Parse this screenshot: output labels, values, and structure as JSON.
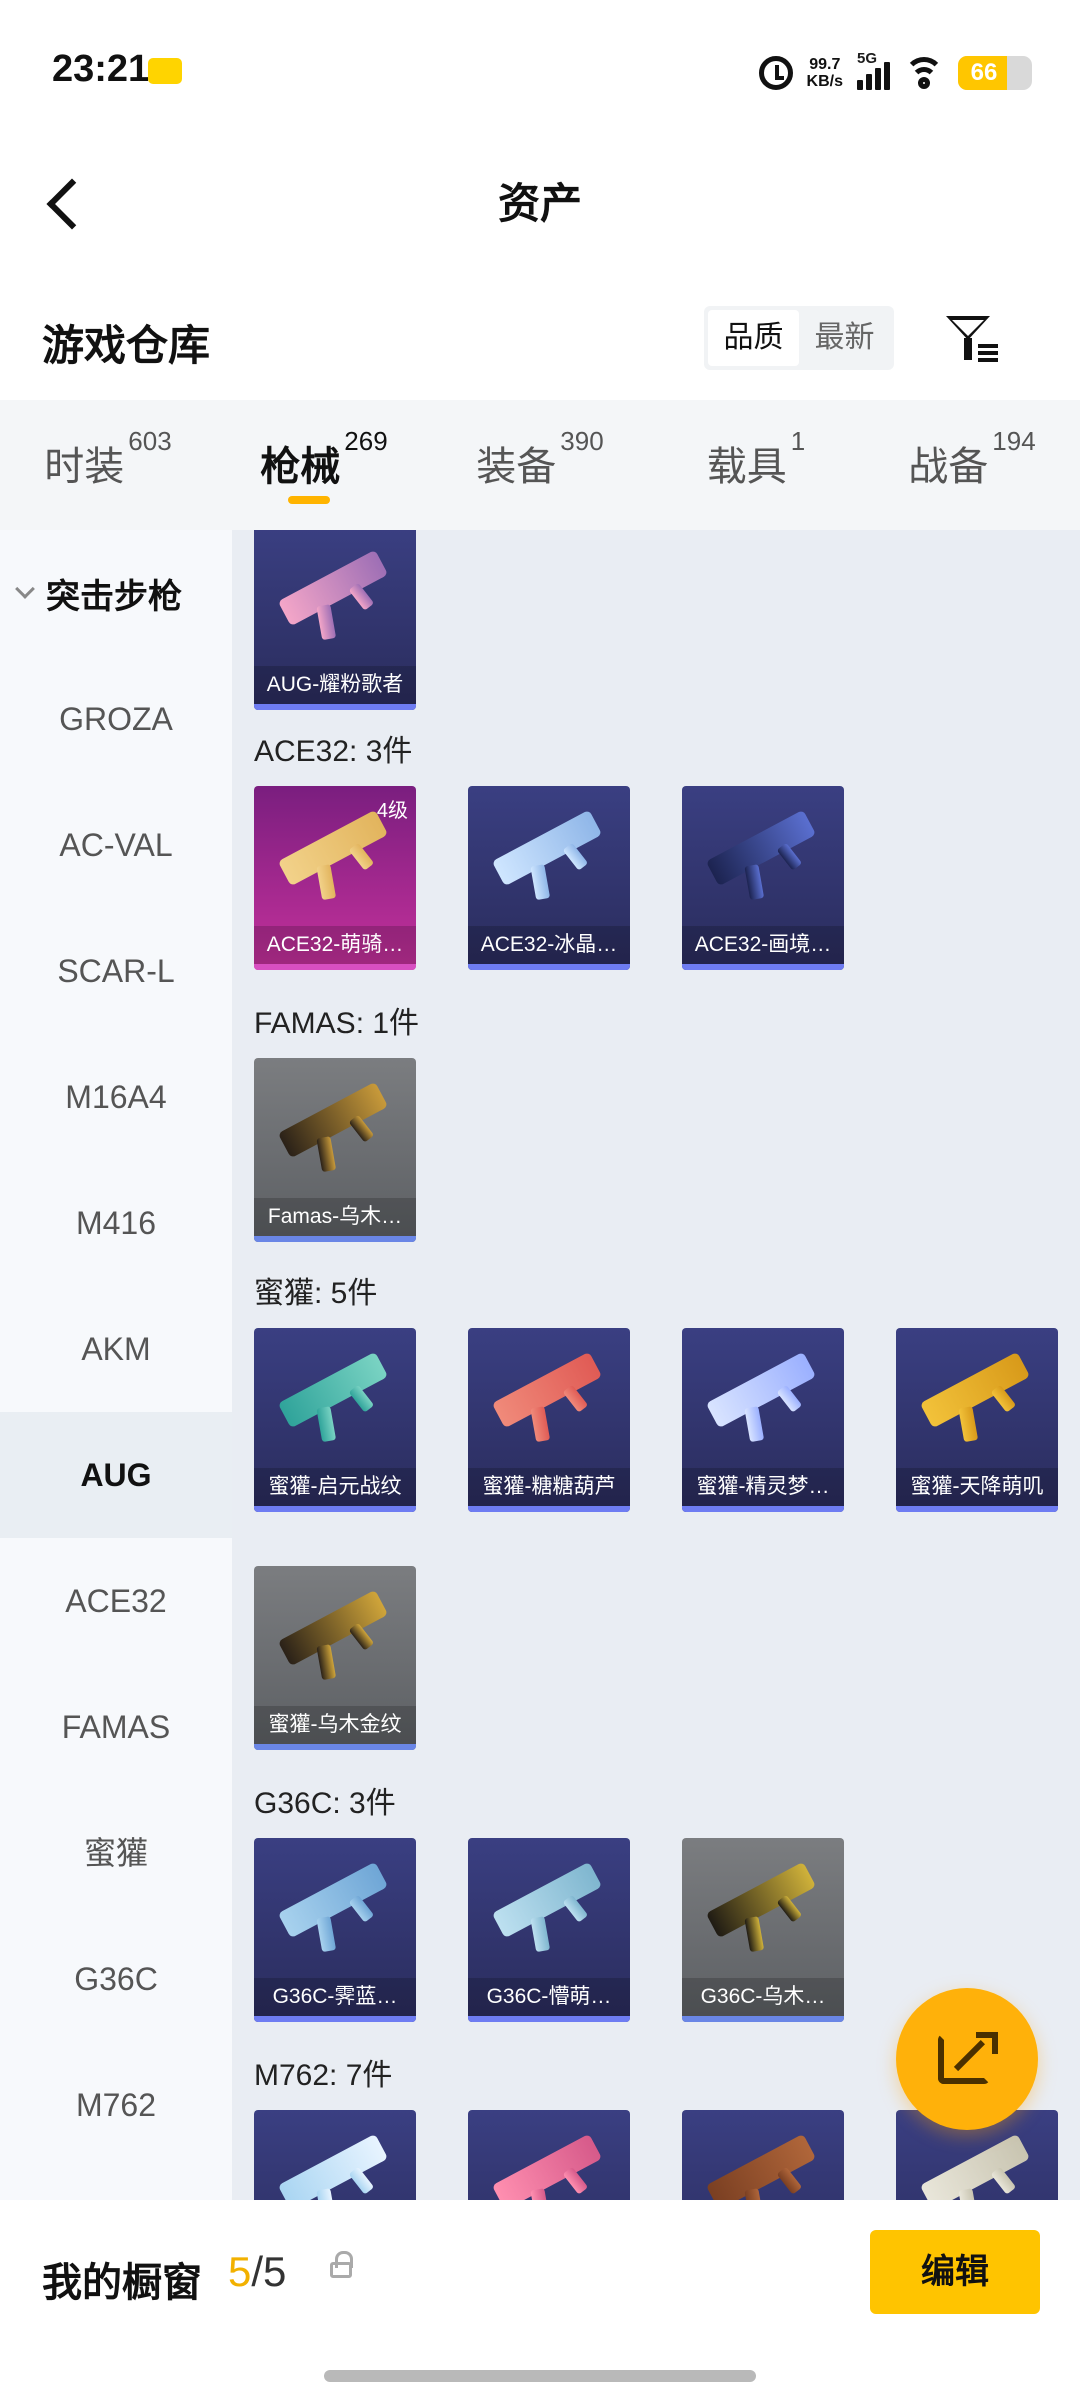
{
  "status_bar": {
    "time": "23:21",
    "net_speed_value": "99.7",
    "net_speed_unit": "KB/s",
    "network": "5G",
    "battery": "66",
    "battery_level": 0.66
  },
  "header": {
    "title": "资产"
  },
  "warehouse": {
    "title": "游戏仓库",
    "sort_options": [
      "品质",
      "最新"
    ],
    "active_sort": "品质"
  },
  "tabs": [
    {
      "label": "时装",
      "count": "603"
    },
    {
      "label": "枪械",
      "count": "269",
      "active": true
    },
    {
      "label": "装备",
      "count": "390"
    },
    {
      "label": "载具",
      "count": "1"
    },
    {
      "label": "战备",
      "count": "194"
    }
  ],
  "side_nav": {
    "category": "突击步枪",
    "items": [
      "GROZA",
      "AC-VAL",
      "SCAR-L",
      "M16A4",
      "M416",
      "AKM",
      "AUG",
      "ACE32",
      "FAMAS",
      "蜜獾",
      "G36C",
      "M762"
    ],
    "active": "AUG"
  },
  "groups": [
    {
      "title": "",
      "items": [
        {
          "name": "AUG-耀粉歌者",
          "tier": "epic",
          "colors": [
            "#f4a6c8",
            "#9e6fb5"
          ]
        }
      ]
    },
    {
      "title": "ACE32: 3件",
      "items": [
        {
          "name": "ACE32-萌骑…",
          "tier": "legend",
          "level": "4级",
          "colors": [
            "#f2d28a",
            "#e2b45d"
          ]
        },
        {
          "name": "ACE32-冰晶…",
          "tier": "epic",
          "colors": [
            "#cfe6ff",
            "#8fb6e8"
          ]
        },
        {
          "name": "ACE32-画境…",
          "tier": "epic",
          "colors": [
            "#1c2350",
            "#5a6fd0"
          ]
        }
      ]
    },
    {
      "title": "FAMAS: 1件",
      "items": [
        {
          "name": "Famas-乌木…",
          "tier": "rare",
          "colors": [
            "#2a2118",
            "#c89a3a"
          ]
        }
      ]
    },
    {
      "title": "蜜獾: 5件",
      "items": [
        {
          "name": "蜜獾-启元战纹",
          "tier": "epic",
          "colors": [
            "#2fa39a",
            "#7ad3c3"
          ]
        },
        {
          "name": "蜜獾-糖糖葫芦",
          "tier": "epic",
          "colors": [
            "#f08a7a",
            "#e05b55"
          ]
        },
        {
          "name": "蜜獾-精灵梦…",
          "tier": "epic",
          "colors": [
            "#d9e4ff",
            "#9bb0ff"
          ]
        },
        {
          "name": "蜜獾-天降萌叽",
          "tier": "epic",
          "colors": [
            "#f2c23a",
            "#d89a1a"
          ]
        },
        {
          "name": "蜜獾-乌木金纹",
          "tier": "rare",
          "colors": [
            "#2a2118",
            "#d0a53a"
          ]
        }
      ]
    },
    {
      "title": "G36C: 3件",
      "items": [
        {
          "name": "G36C-霁蓝…",
          "tier": "epic",
          "colors": [
            "#a8d2ee",
            "#6fa6d6"
          ]
        },
        {
          "name": "G36C-懵萌…",
          "tier": "epic",
          "colors": [
            "#bde0f0",
            "#7fb6cf"
          ]
        },
        {
          "name": "G36C-乌木…",
          "tier": "rare",
          "colors": [
            "#1f1b14",
            "#d0b23a"
          ]
        }
      ]
    },
    {
      "title": "M762: 7件",
      "items": [
        {
          "name": "",
          "tier": "epic",
          "colors": [
            "#a9d5f2",
            "#e8f4ff"
          ]
        },
        {
          "name": "",
          "tier": "epic",
          "colors": [
            "#ff8fb0",
            "#d65a8a"
          ]
        },
        {
          "name": "",
          "tier": "epic",
          "colors": [
            "#7a3f22",
            "#b0663a"
          ]
        },
        {
          "name": "",
          "tier": "epic",
          "colors": [
            "#e9e6da",
            "#c8c4b0"
          ]
        }
      ]
    }
  ],
  "bottom": {
    "window_label": "我的橱窗",
    "window_current": "5",
    "window_total": "5",
    "edit_label": "编辑"
  },
  "colors": {
    "accent": "#ffc400",
    "tab_underline": "#ffb400",
    "epic_card": "#2d3066",
    "legend_card": "#b5309a"
  }
}
